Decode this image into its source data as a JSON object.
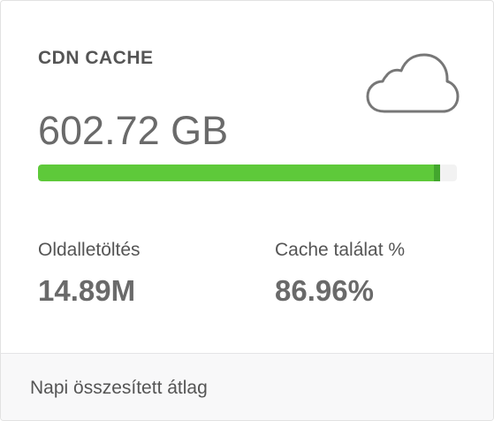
{
  "card": {
    "title": "CDN CACHE",
    "icon": "cloud-icon",
    "total_value": "602.72 GB",
    "progress_fraction": 0.96,
    "progress_color": "#5ec93a",
    "progress_cap_color": "#43a62e",
    "stats": [
      {
        "label": "Oldalletöltés",
        "value": "14.89M"
      },
      {
        "label": "Cache találat %",
        "value": "86.96%"
      }
    ],
    "footer": "Napi összesített átlag"
  }
}
